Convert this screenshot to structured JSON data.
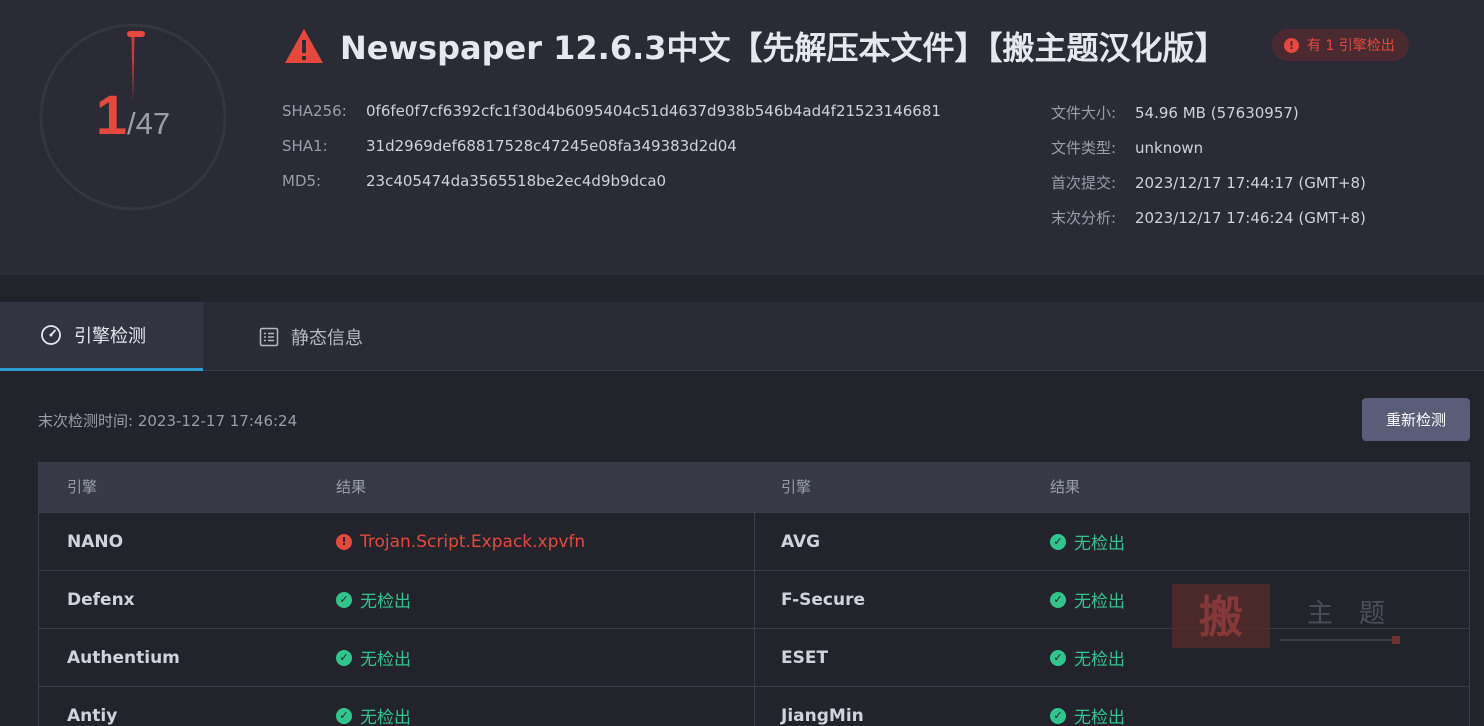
{
  "summary": {
    "detected": "1",
    "total": "/47"
  },
  "file": {
    "title": "Newspaper 12.6.3中文【先解压本文件】【搬主题汉化版】",
    "badge": "有 1 引擎检出",
    "hashes": [
      {
        "label": "SHA256:",
        "value": "0f6fe0f7cf6392cfc1f30d4b6095404c51d4637d938b546b4ad4f21523146681"
      },
      {
        "label": "SHA1:",
        "value": "31d2969def68817528c47245e08fa349383d2d04"
      },
      {
        "label": "MD5:",
        "value": "23c405474da3565518be2ec4d9b9dca0"
      }
    ],
    "meta": [
      {
        "label": "文件大小:",
        "value": "54.96 MB (57630957)"
      },
      {
        "label": "文件类型:",
        "value": "unknown"
      },
      {
        "label": "首次提交:",
        "value": "2023/12/17 17:44:17 (GMT+8)"
      },
      {
        "label": "末次分析:",
        "value": "2023/12/17 17:46:24 (GMT+8)"
      }
    ]
  },
  "tabs": [
    {
      "label": "引擎检测",
      "icon": "gauge-icon",
      "active": true
    },
    {
      "label": "静态信息",
      "icon": "document-list-icon",
      "active": false
    }
  ],
  "scan": {
    "last_scan": "末次检测时间: 2023-12-17 17:46:24",
    "rescan_label": "重新检测"
  },
  "table": {
    "headers": [
      "引擎",
      "结果",
      "引擎",
      "结果"
    ],
    "rows": [
      {
        "left_engine": "NANO",
        "left_result": "Trojan.Script.Expack.xpvfn",
        "left_status": "detected",
        "right_engine": "AVG",
        "right_result": "无检出",
        "right_status": "clean"
      },
      {
        "left_engine": "Defenx",
        "left_result": "无检出",
        "left_status": "clean",
        "right_engine": "F-Secure",
        "right_result": "无检出",
        "right_status": "clean"
      },
      {
        "left_engine": "Authentium",
        "left_result": "无检出",
        "left_status": "clean",
        "right_engine": "ESET",
        "right_result": "无检出",
        "right_status": "clean"
      },
      {
        "left_engine": "Antiy",
        "left_result": "无检出",
        "left_status": "clean",
        "right_engine": "JiangMin",
        "right_result": "无检出",
        "right_status": "clean"
      }
    ]
  },
  "watermark": {
    "text": "搬主题"
  },
  "colors": {
    "danger": "#e5483d",
    "ok": "#31c48d",
    "accent": "#2e9dd6",
    "button": "#5a5d78"
  }
}
